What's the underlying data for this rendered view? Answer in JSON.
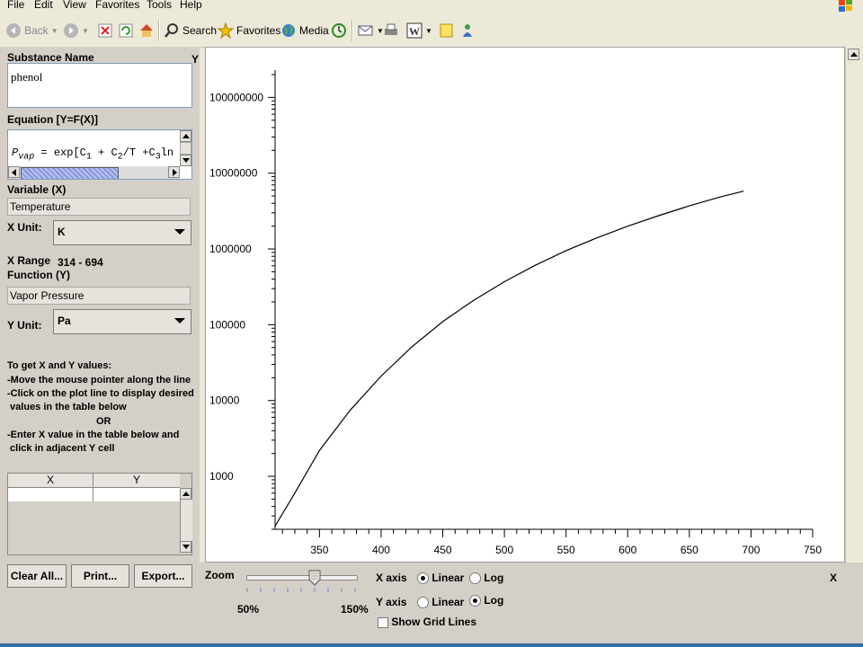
{
  "menu": [
    "File",
    "Edit",
    "View",
    "Favorites",
    "Tools",
    "Help"
  ],
  "toolbar": {
    "back": "Back",
    "search": "Search",
    "favorites": "Favorites",
    "media": "Media"
  },
  "left": {
    "substance_label": "Substance Name",
    "y_marker": "Y",
    "substance_value": "phenol",
    "equation_label": "Equation [Y=F(X)]",
    "equation_text": "= exp[C",
    "equation_pvap_p": "P",
    "equation_pvap_sub": "vap",
    "equation_rest": "+ C",
    "equation_rest2": "/T +C",
    "equation_tail": "ln",
    "variable_label": "Variable (X)",
    "variable_value": "Temperature",
    "x_unit_label": "X Unit:",
    "x_unit_value": "K",
    "x_range_label": "X Range",
    "x_range_value": "314 - 694",
    "function_label": "Function (Y)",
    "function_value": "Vapor Pressure",
    "y_unit_label": "Y Unit:",
    "y_unit_value": "Pa",
    "instructions": [
      "To get X and Y values:",
      "-Move the mouse pointer along the line",
      "-Click on the plot line to display desired",
      " values in the table below",
      "OR",
      "-Enter X value in the table below and",
      " click in adjacent Y cell"
    ],
    "table_headers": [
      "X",
      "Y"
    ],
    "buttons": {
      "clear": "Clear All...",
      "print": "Print...",
      "export": "Export..."
    }
  },
  "bottom": {
    "zoom_label": "Zoom",
    "zoom_min": "50%",
    "zoom_max": "150%",
    "zoom_level": 0.62,
    "x_axis_label": "X axis",
    "y_axis_label": "Y axis",
    "linear": "Linear",
    "log": "Log",
    "x_axis_mode": "Linear",
    "y_axis_mode": "Log",
    "grid_label": "Show Grid Lines",
    "x_marker": "X"
  },
  "chart_data": {
    "type": "line",
    "x_scale": "linear",
    "y_scale": "log",
    "xlim": [
      314,
      750
    ],
    "ylim": [
      200,
      200000000
    ],
    "x_ticks": [
      350,
      400,
      450,
      500,
      550,
      600,
      650,
      700,
      750
    ],
    "y_ticks": [
      1000,
      10000,
      100000,
      1000000,
      10000000,
      100000000
    ],
    "y_tick_labels": [
      "1000",
      "10000",
      "100000",
      "1000000",
      "10000000",
      "100000000"
    ],
    "grid": false,
    "series": [
      {
        "x": [
          314,
          330,
          350,
          375,
          400,
          425,
          450,
          475,
          500,
          525,
          550,
          575,
          600,
          625,
          650,
          675,
          694
        ],
        "y": [
          220,
          600,
          2200,
          7500,
          21000,
          51000,
          110000,
          210000,
          370000,
          610000,
          950000,
          1400000,
          2000000,
          2750000,
          3700000,
          4850000,
          5800000
        ]
      }
    ],
    "line_color": "#000000"
  }
}
